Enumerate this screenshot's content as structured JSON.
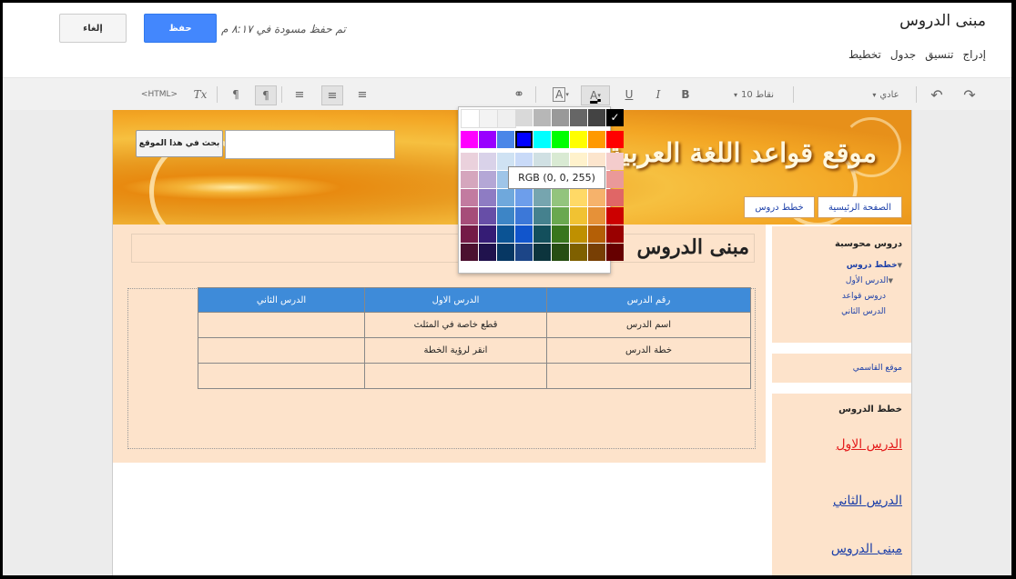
{
  "header": {
    "page_title": "مبنى الدروس",
    "menu": [
      "إدراج",
      "تنسيق",
      "جدول",
      "تخطيط"
    ],
    "save_label": "حفظ",
    "cancel_label": "إلغاء",
    "status": "تم حفظ مسودة في ٨:١٧ م"
  },
  "toolbar": {
    "undo_icon": "undo-icon",
    "redo_icon": "redo-icon",
    "style_select": "عادي",
    "size_select": "10 نقاط",
    "bold": "B",
    "italic": "I",
    "underline": "U",
    "font_color": "A",
    "highlight": "A",
    "link_icon": "link-icon",
    "html": "<HTML>",
    "clear_format": "Tx"
  },
  "site": {
    "title": "موقع قواعد اللغة العربية",
    "search_button": "بحث في هذا الموقع",
    "search_value": "",
    "nav": [
      "الصفحة الرئيسية",
      "خطط دروس"
    ]
  },
  "content": {
    "title": "مبنى الدروس",
    "table": {
      "headers": [
        "رقم الدرس",
        "الدرس الاول",
        "الدرس الثاني"
      ],
      "rows": [
        [
          "اسم الدرس",
          "قطع خاصة في المثلث",
          ""
        ],
        [
          "خطة الدرس",
          "انقر لرؤية الخطة",
          ""
        ],
        [
          "",
          "",
          ""
        ]
      ]
    }
  },
  "sidebar": {
    "nav_title": "دروس محوسبة",
    "nav_items": [
      "خطط دروس",
      "الدرس الأول",
      "دروس قواعد",
      "الدرس الثاني"
    ],
    "link1": "موقع القاسمي",
    "lessons_title": "خطط الدروس",
    "lesson_links": [
      "الدرس الاول",
      "الدرس الثاني",
      "مبنى الدروس"
    ],
    "lesson_link_colors": [
      "#e41b1b",
      "#1a3ea8",
      "#1a3ea8"
    ]
  },
  "color_picker": {
    "tooltip": "RGB (0, 0, 255)",
    "selected": "#0000ff",
    "grays": [
      "#ffffff",
      "#f3f3f3",
      "#efefef",
      "#d9d9d9",
      "#b7b7b7",
      "#999999",
      "#666666",
      "#434343",
      "#000000"
    ],
    "brights": [
      "#ff00ff",
      "#9900ff",
      "#4a86e8",
      "#0000ff",
      "#00ffff",
      "#00ff00",
      "#ffff00",
      "#ff9900",
      "#ff0000"
    ],
    "grid": [
      [
        "#ead1dc",
        "#d9d2e9",
        "#cfe2f3",
        "#c9daf8",
        "#d0e0e3",
        "#d9ead3",
        "#fff2cc",
        "#fce5cd",
        "#f4cccc"
      ],
      [
        "#d5a6bd",
        "#b4a7d6",
        "#9fc5e8",
        "#a4c2f4",
        "#a2c4c9",
        "#b6d7a8",
        "#ffe599",
        "#f9cb9c",
        "#ea9999"
      ],
      [
        "#c27ba0",
        "#8e7cc3",
        "#6fa8dc",
        "#6d9eeb",
        "#76a5af",
        "#93c47d",
        "#ffd966",
        "#f6b26b",
        "#e06666"
      ],
      [
        "#a64d79",
        "#674ea7",
        "#3d85c6",
        "#3c78d8",
        "#45818e",
        "#6aa84f",
        "#f1c232",
        "#e69138",
        "#cc0000"
      ],
      [
        "#741b47",
        "#351c75",
        "#0b5394",
        "#1155cc",
        "#134f5c",
        "#38761d",
        "#bf9000",
        "#b45f06",
        "#990000"
      ],
      [
        "#4c1130",
        "#20124d",
        "#073763",
        "#1c4587",
        "#0c343d",
        "#274e13",
        "#7f6000",
        "#783f04",
        "#660000"
      ]
    ]
  }
}
